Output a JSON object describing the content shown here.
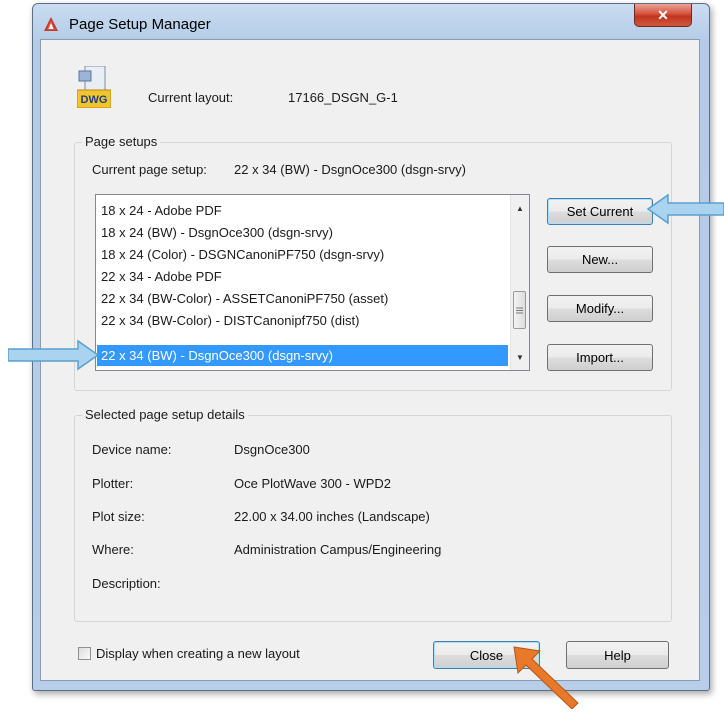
{
  "window": {
    "title": "Page Setup Manager",
    "close_glyph": "✕"
  },
  "current_layout": {
    "label": "Current layout:",
    "value": "17166_DSGN_G-1",
    "icon_text": "DWG"
  },
  "page_setups": {
    "group_label": "Page setups",
    "current_label": "Current page setup:",
    "current_value": "22 x 34 (BW) - DsgnOce300 (dsgn-srvy)",
    "items": [
      "18 x 24 - Adobe PDF",
      "18 x 24 (BW) - DsgnOce300 (dsgn-srvy)",
      "18 x 24 (Color) - DSGNCanoniPF750 (dsgn-srvy)",
      "22 x 34 - Adobe PDF",
      "22 x 34 (BW-Color) - ASSETCanoniPF750 (asset)",
      "22 x 34 (BW-Color) - DISTCanonipf750 (dist)",
      "22 x 34 (BW) - DsgnOce300 (dsgn-srvy)"
    ],
    "selected_index": 6
  },
  "buttons": {
    "set_current": "Set Current",
    "new": "New...",
    "modify": "Modify...",
    "import": "Import...",
    "close": "Close",
    "help": "Help"
  },
  "details": {
    "group_label": "Selected page setup details",
    "rows": [
      {
        "label": "Device name:",
        "value": "DsgnOce300"
      },
      {
        "label": "Plotter:",
        "value": "Oce PlotWave 300 - WPD2"
      },
      {
        "label": "Plot size:",
        "value": "22.00 x 34.00 inches (Landscape)"
      },
      {
        "label": "Where:",
        "value": "Administration Campus/Engineering"
      },
      {
        "label": "Description:",
        "value": ""
      }
    ]
  },
  "display_checkbox": {
    "label": "Display when creating a new layout",
    "checked": false
  },
  "colors": {
    "selection": "#3399ff",
    "callout_arrow_blue": "#a9d3ee",
    "callout_arrow_orange": "#e8782a"
  }
}
